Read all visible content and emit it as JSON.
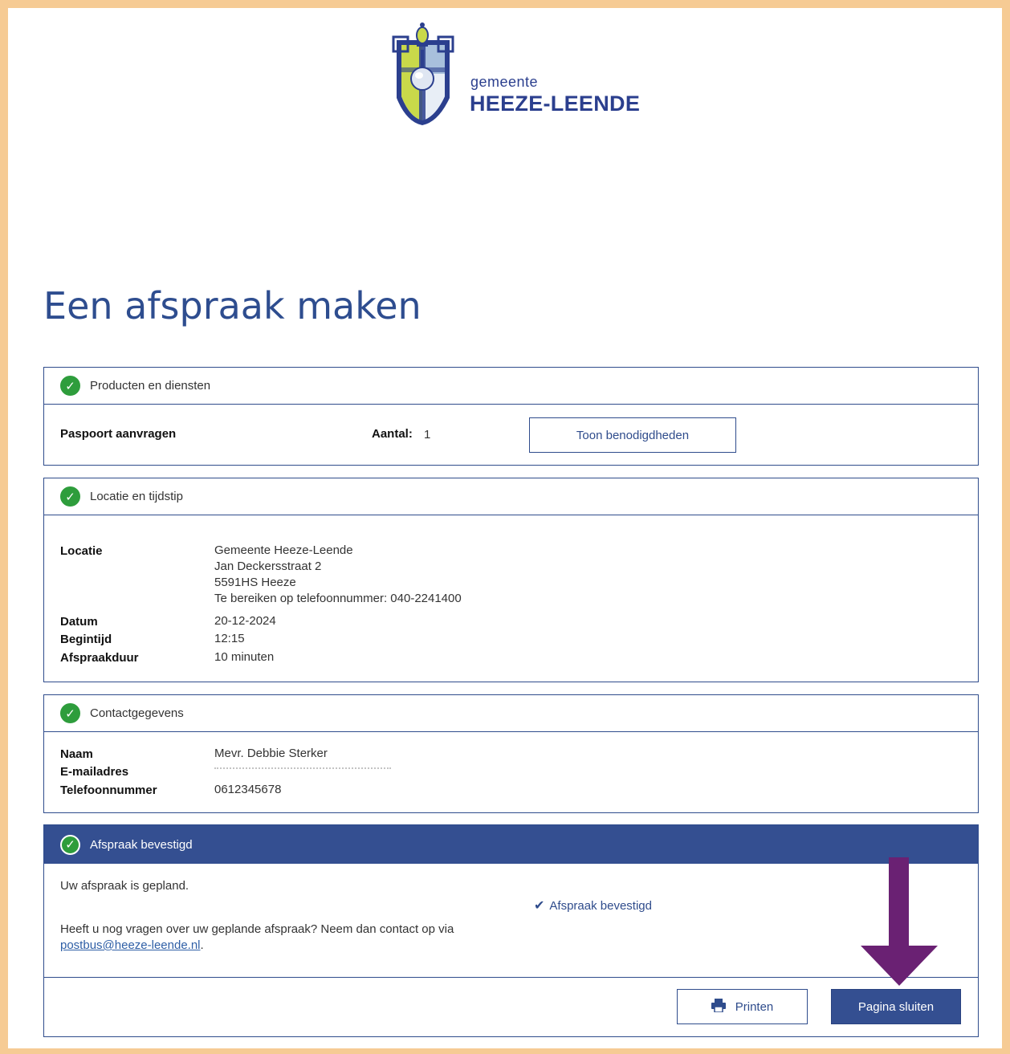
{
  "logo": {
    "small": "gemeente",
    "big": "HEEZE-LEENDE"
  },
  "page_title": "Een afspraak maken",
  "products": {
    "header": "Producten en diensten",
    "item_label": "Paspoort aanvragen",
    "count_label": "Aantal:",
    "count_value": "1",
    "button": "Toon benodigdheden"
  },
  "location": {
    "header": "Locatie en tijdstip",
    "location_label": "Locatie",
    "location_lines": [
      "Gemeente Heeze-Leende",
      "Jan Deckersstraat 2",
      "5591HS Heeze",
      "Te bereiken op telefoonnummer: 040-2241400"
    ],
    "date_label": "Datum",
    "date_value": "20-12-2024",
    "start_label": "Begintijd",
    "start_value": "12:15",
    "duration_label": "Afspraakduur",
    "duration_value": "10 minuten"
  },
  "contact": {
    "header": "Contactgegevens",
    "name_label": "Naam",
    "name_value": "Mevr. Debbie Sterker",
    "email_label": "E-mailadres",
    "phone_label": "Telefoonnummer",
    "phone_value": "0612345678"
  },
  "confirmation": {
    "header": "Afspraak bevestigd",
    "planned_text": "Uw afspraak is gepland.",
    "status_text": "Afspraak bevestigd",
    "questions_text": "Heeft u nog vragen over uw geplande afspraak? Neem dan contact op via",
    "email_link": "postbus@heeze-leende.nl",
    "period": "."
  },
  "footer": {
    "print_button": "Printen",
    "close_button": "Pagina sluiten"
  },
  "colors": {
    "accent": "#344f91",
    "success": "#2e9d3c",
    "frame": "#f6cb94",
    "arrow": "#6a2173"
  }
}
